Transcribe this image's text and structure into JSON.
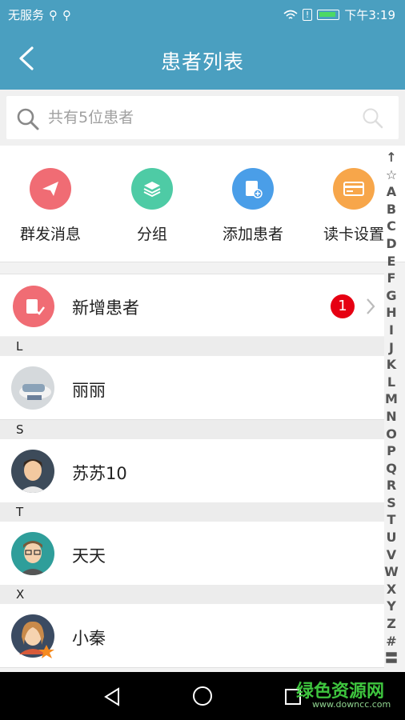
{
  "status_bar": {
    "carrier": "无服务",
    "time": "下午3:19"
  },
  "header": {
    "title": "患者列表"
  },
  "search": {
    "placeholder": "共有5位患者"
  },
  "quick_actions": [
    {
      "label": "群发消息",
      "icon": "paper-plane-icon",
      "color": "#f06c74"
    },
    {
      "label": "分组",
      "icon": "layers-icon",
      "color": "#4ecba5"
    },
    {
      "label": "添加患者",
      "icon": "add-patient-icon",
      "color": "#4a9ee8"
    },
    {
      "label": "读卡设置",
      "icon": "card-icon",
      "color": "#f7a64a"
    }
  ],
  "new_patients": {
    "label": "新增患者",
    "badge": "1"
  },
  "sections": [
    {
      "letter": "L",
      "patients": [
        {
          "name": "丽丽"
        }
      ]
    },
    {
      "letter": "S",
      "patients": [
        {
          "name": "苏苏10"
        }
      ]
    },
    {
      "letter": "T",
      "patients": [
        {
          "name": "天天"
        }
      ]
    },
    {
      "letter": "X",
      "patients": [
        {
          "name": "小秦"
        }
      ]
    }
  ],
  "index_letters": [
    "↑",
    "☆",
    "A",
    "B",
    "C",
    "D",
    "E",
    "F",
    "G",
    "H",
    "I",
    "J",
    "K",
    "L",
    "M",
    "N",
    "O",
    "P",
    "Q",
    "R",
    "S",
    "T",
    "U",
    "V",
    "W",
    "X",
    "Y",
    "Z",
    "#",
    "〓"
  ],
  "watermark": {
    "text": "绿色资源网",
    "url": "www.downcc.com"
  },
  "colors": {
    "accent": "#4a9fc0",
    "badge": "#e60012"
  }
}
